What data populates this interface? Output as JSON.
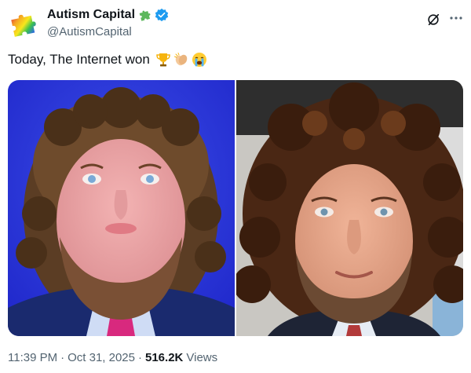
{
  "author": {
    "display_name": "Autism Capital",
    "handle": "@AutismCapital",
    "avatar_icon": "puzzle-piece-icon",
    "name_badge_icon": "green-puzzle-piece-icon",
    "verified_icon": "verified-badge-icon"
  },
  "tweet": {
    "text": "Today, The Internet won",
    "emojis": [
      "trophy-icon",
      "clapping-hands-icon",
      "loudly-crying-face-icon"
    ]
  },
  "media": {
    "photos": [
      {
        "label": "left-photo"
      },
      {
        "label": "right-photo"
      }
    ]
  },
  "meta": {
    "time": "11:39 PM",
    "date": "Oct 31, 2025",
    "views_count": "516.2K",
    "views_label": "Views",
    "separator": "·"
  },
  "colors": {
    "verified_blue": "#1d9bf0",
    "secondary_text": "#536471",
    "primary_text": "#0f1419"
  },
  "actions": {
    "grok_icon": "grok-icon",
    "more_icon": "more-icon"
  }
}
